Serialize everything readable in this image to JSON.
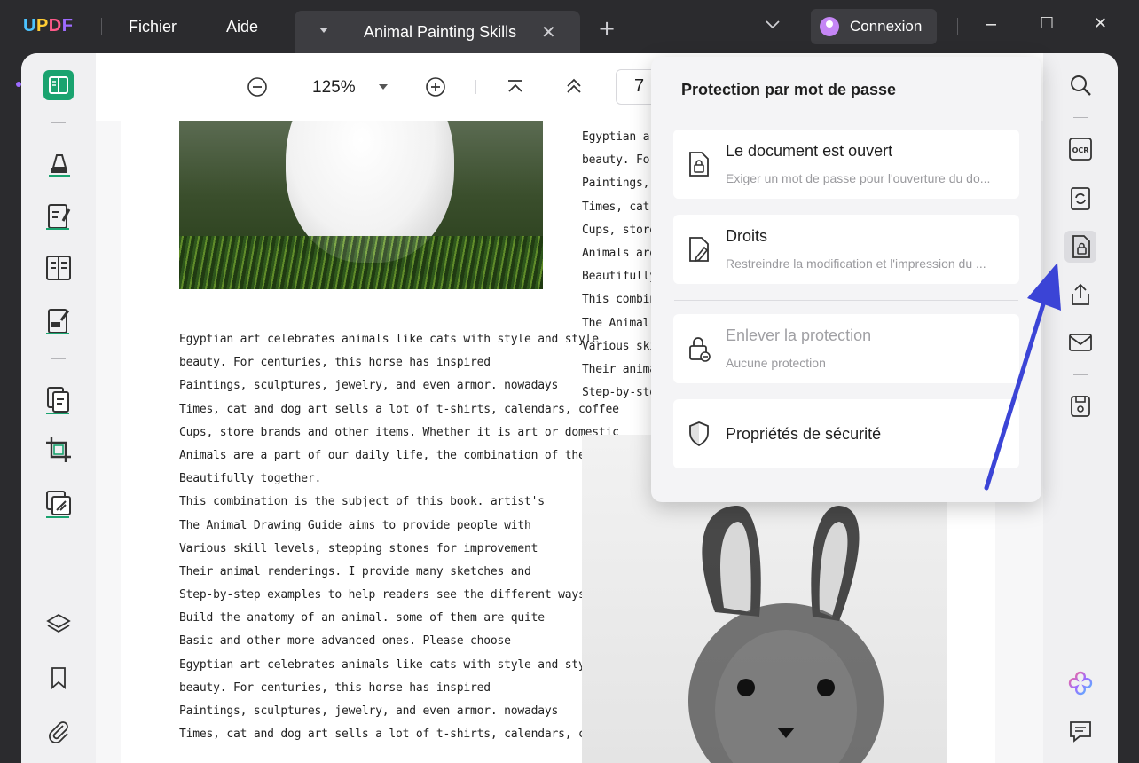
{
  "app": {
    "logo": "UPDF"
  },
  "menu": {
    "file": "Fichier",
    "help": "Aide"
  },
  "tab": {
    "title": "Animal Painting Skills"
  },
  "account": {
    "login_label": "Connexion"
  },
  "toolbar": {
    "zoom": "125%",
    "page": "7"
  },
  "document": {
    "col1_lines": [
      "Egyptian art celebrates animals like cats with style and style",
      "beauty. For centuries, this horse has inspired",
      "Paintings, sculptures, jewelry, and even armor. nowadays",
      "Times, cat and dog art sells a lot of t-shirts, calendars, coffee",
      "Cups, store brands and other items. Whether it is art or domestic",
      "Animals are a part of our daily life, the combination of the two",
      "Beautifully together.",
      "This combination is the subject of this book. artist's",
      "The Animal Drawing Guide aims to provide people with",
      "Various skill levels, stepping stones for improvement",
      "Their animal renderings. I provide many sketches and",
      "Step-by-step examples to help readers see the different ways",
      "Build the anatomy of an animal. some of them are quite",
      "Basic and other more advanced ones. Please choose",
      "Egyptian art celebrates animals like cats with style and style",
      "beauty. For centuries, this horse has inspired",
      "Paintings, sculptures, jewelry, and even armor. nowadays",
      "Times, cat and dog art sells a lot of t-shirts, calendars, coffee"
    ],
    "col2_lines": [
      "Egyptian art c",
      "beauty. For c",
      "Paintings, sc",
      "Times, cat an",
      "Cups, store b",
      "Animals are a",
      "Beautifully to",
      "This combina",
      "The Animal D",
      "Various skill",
      "Their animal",
      "Step-by-step"
    ]
  },
  "protection_menu": {
    "title": "Protection par mot de passe",
    "open_password": {
      "title": "Le document est ouvert",
      "subtitle": "Exiger un mot de passe pour l'ouverture du do..."
    },
    "permissions": {
      "title": "Droits",
      "subtitle": "Restreindre la modification et l'impression du ..."
    },
    "remove": {
      "title": "Enlever la protection",
      "subtitle": "Aucune protection"
    },
    "security_props": {
      "title": "Propriétés de sécurité"
    }
  },
  "icons": {
    "left": [
      "reader-icon",
      "comment-highlighter-icon",
      "edit-pdf-icon",
      "form-icon",
      "fill-sign-icon",
      "organize-pages-icon",
      "crop-icon",
      "page-tools-icon",
      "layers-icon",
      "bookmark-icon",
      "attachment-icon"
    ],
    "right": [
      "search-icon",
      "ocr-icon",
      "convert-icon",
      "protect-icon",
      "share-icon",
      "mail-icon",
      "save-icon",
      "ai-assistant-icon",
      "comments-panel-icon"
    ]
  },
  "colors": {
    "accent": "#1aa36f",
    "arrow": "#3b44d6",
    "ai_gradient": [
      "#ff6b8a",
      "#9d6bff",
      "#4cc3ff"
    ]
  }
}
